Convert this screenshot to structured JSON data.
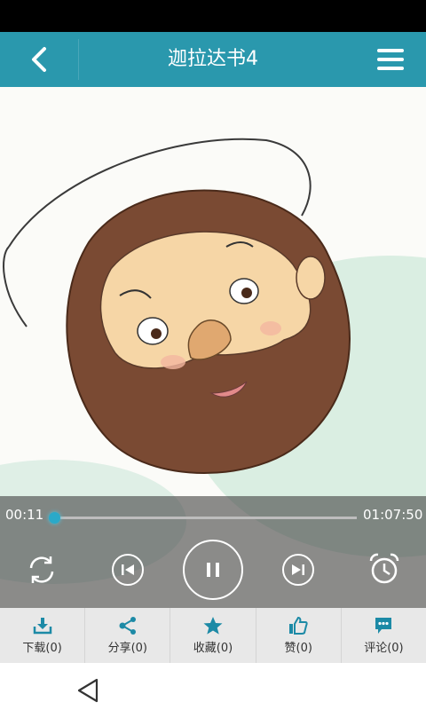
{
  "header": {
    "title": "迦拉达书4"
  },
  "player": {
    "current_time": "00:11",
    "total_time": "01:07:50",
    "progress_fraction": 0.003
  },
  "toolbar": {
    "items": [
      {
        "label": "下载(0)",
        "icon": "download-icon"
      },
      {
        "label": "分享(0)",
        "icon": "share-icon"
      },
      {
        "label": "收藏(0)",
        "icon": "star-icon"
      },
      {
        "label": "赞(0)",
        "icon": "thumbs-up-icon"
      },
      {
        "label": "评论(0)",
        "icon": "comment-icon"
      }
    ]
  },
  "colors": {
    "brand": "#2a98ad",
    "accent": "#2aa9c9",
    "icon": "#1c8aa6"
  }
}
